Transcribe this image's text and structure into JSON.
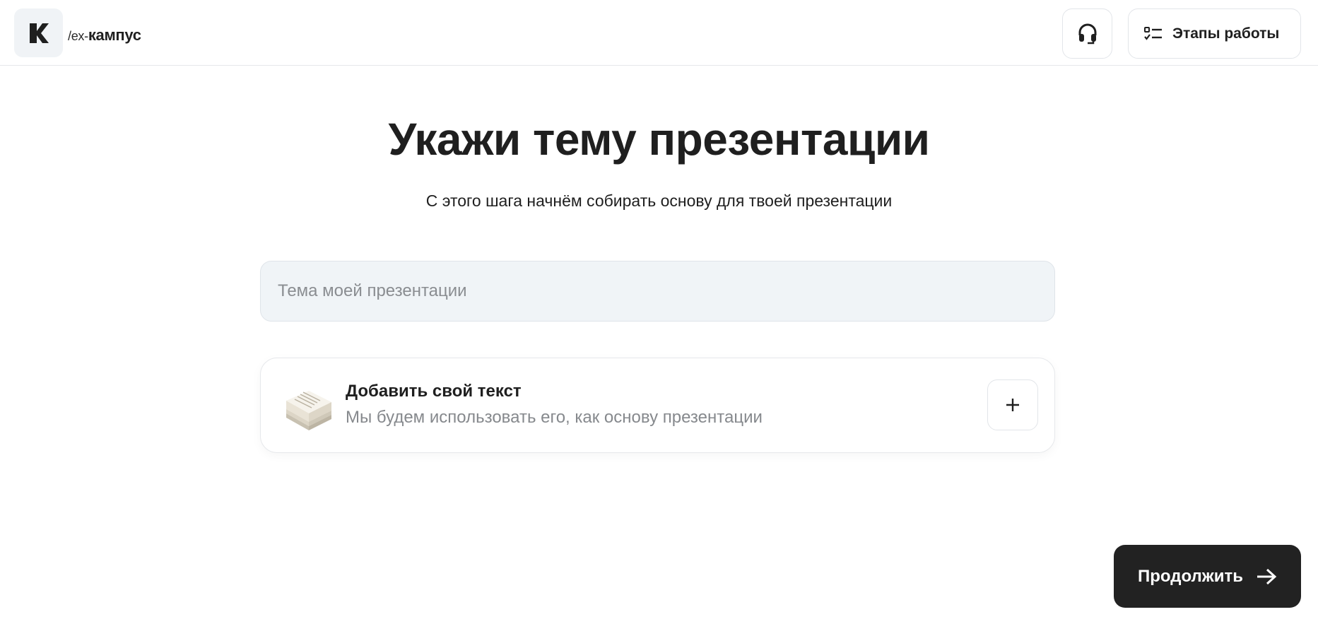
{
  "header": {
    "logo_prefix": "/ex-",
    "logo_name": "кампус",
    "support_icon": "headset-icon",
    "stages_label": "Этапы работы",
    "stages_icon": "checklist-icon"
  },
  "main": {
    "title": "Укажи тему презентации",
    "subtitle": "С этого шага начнём собирать основу для твоей презентации",
    "topic_input": {
      "value": "",
      "placeholder": "Тема моей презентации"
    },
    "add_text_card": {
      "title": "Добавить свой текст",
      "subtitle": "Мы будем использовать его, как основу презентации",
      "icon": "paper-stack-icon",
      "action_icon": "plus-icon"
    }
  },
  "footer": {
    "continue_label": "Продолжить",
    "continue_icon": "arrow-right-icon"
  },
  "colors": {
    "primary_button": "#222222",
    "input_background": "#f0f4f7",
    "muted_text": "#86898d",
    "border": "#e2e5e9"
  }
}
